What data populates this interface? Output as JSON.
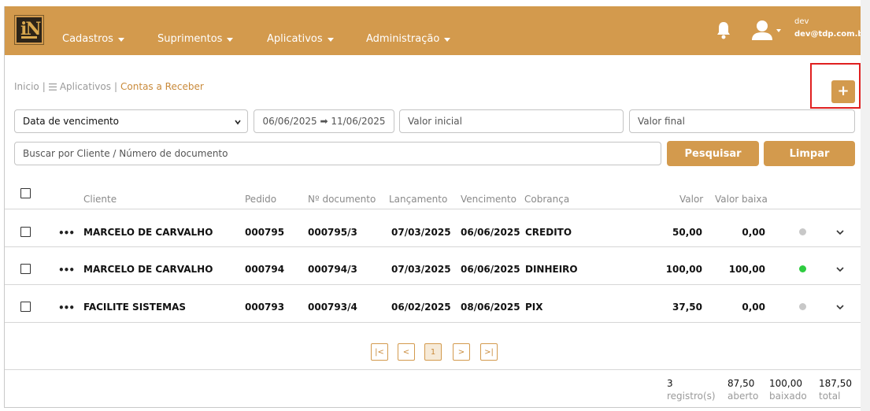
{
  "navbar": {
    "menus": [
      {
        "label": "Cadastros"
      },
      {
        "label": "Suprimentos"
      },
      {
        "label": "Aplicativos"
      },
      {
        "label": "Administração"
      }
    ],
    "user": {
      "name": "dev",
      "email": "dev@tdp.com.br"
    }
  },
  "breadcrumb": {
    "home": "Inicio",
    "sep1": "|",
    "apps": "Aplicativos",
    "sep2": "|",
    "current": "Contas a Receber"
  },
  "toolbar": {
    "add_label": "+"
  },
  "filters": {
    "date_type": "Data de vencimento",
    "date_range": "06/06/2025 ➡ 11/06/2025",
    "valor_inicial_placeholder": "Valor inicial",
    "valor_final_placeholder": "Valor final",
    "search_placeholder": "Buscar por Cliente / Número de documento",
    "search_button": "Pesquisar",
    "clear_button": "Limpar"
  },
  "table": {
    "headers": {
      "cliente": "Cliente",
      "pedido": "Pedido",
      "documento": "Nº documento",
      "lancamento": "Lançamento",
      "vencimento": "Vencimento",
      "cobranca": "Cobrança",
      "valor": "Valor",
      "valor_baixa": "Valor baixa"
    },
    "rows": [
      {
        "cliente": "MARCELO DE CARVALHO",
        "pedido": "000795",
        "documento": "000795/3",
        "lancamento": "07/03/2025",
        "vencimento": "06/06/2025",
        "cobranca": "CREDITO",
        "valor": "50,00",
        "valor_baixa": "0,00",
        "status_color": "#c8c8c8"
      },
      {
        "cliente": "MARCELO DE CARVALHO",
        "pedido": "000794",
        "documento": "000794/3",
        "lancamento": "07/03/2025",
        "vencimento": "06/06/2025",
        "cobranca": "DINHEIRO",
        "valor": "100,00",
        "valor_baixa": "100,00",
        "status_color": "#2ecc40"
      },
      {
        "cliente": "FACILITE SISTEMAS",
        "pedido": "000793",
        "documento": "000793/4",
        "lancamento": "06/02/2025",
        "vencimento": "08/06/2025",
        "cobranca": "PIX",
        "valor": "37,50",
        "valor_baixa": "0,00",
        "status_color": "#c8c8c8"
      }
    ]
  },
  "pagination": {
    "first": "|<",
    "prev": "<",
    "current": "1",
    "next": ">",
    "last": ">|"
  },
  "summary": {
    "registros": {
      "value": "3",
      "label": "registro(s)"
    },
    "aberto": {
      "value": "87,50",
      "label": "aberto"
    },
    "baixado": {
      "value": "100,00",
      "label": "baixado"
    },
    "total": {
      "value": "187,50",
      "label": "total"
    }
  },
  "colors": {
    "brand": "#d39a4d",
    "accent_text": "#c98a3a",
    "highlight": "#e02020"
  }
}
